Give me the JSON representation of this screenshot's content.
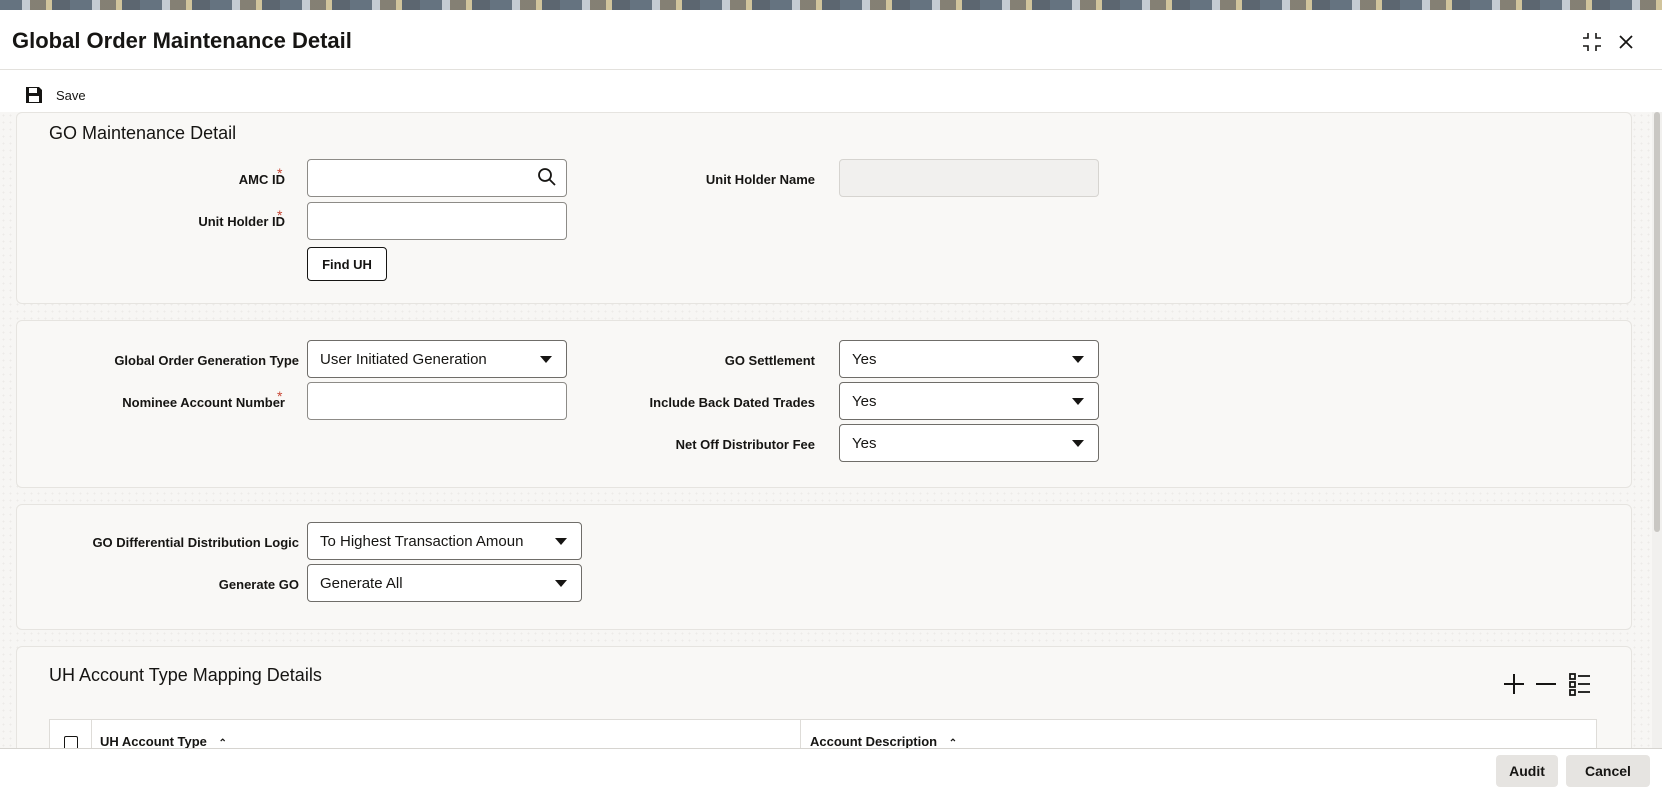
{
  "window": {
    "title": "Global Order Maintenance Detail"
  },
  "toolbar": {
    "save_label": "Save"
  },
  "go_detail": {
    "section_title": "GO Maintenance Detail",
    "amc_id_label": "AMC ID",
    "amc_id_value": "",
    "unit_holder_id_label": "Unit Holder ID",
    "unit_holder_id_value": "",
    "find_uh_label": "Find UH",
    "unit_holder_name_label": "Unit Holder Name",
    "unit_holder_name_value": ""
  },
  "generation": {
    "go_generation_type_label": "Global Order Generation Type",
    "go_generation_type_value": "User Initiated Generation",
    "nominee_account_label": "Nominee Account Number",
    "nominee_account_value": "",
    "go_settlement_label": "GO Settlement",
    "go_settlement_value": "Yes",
    "include_back_dated_label": "Include Back Dated Trades",
    "include_back_dated_value": "Yes",
    "net_off_fee_label": "Net Off Distributor Fee",
    "net_off_fee_value": "Yes"
  },
  "distribution": {
    "logic_label": "GO Differential Distribution Logic",
    "logic_value": "To Highest Transaction Amoun",
    "generate_go_label": "Generate GO",
    "generate_go_value": "Generate All"
  },
  "mapping": {
    "section_title": "UH Account Type Mapping Details",
    "columns": [
      "UH Account Type",
      "Account Description"
    ]
  },
  "footer": {
    "audit_label": "Audit",
    "cancel_label": "Cancel"
  },
  "colors": {
    "required_marker": "#c74634",
    "panel_bg": "#f9f8f6"
  }
}
